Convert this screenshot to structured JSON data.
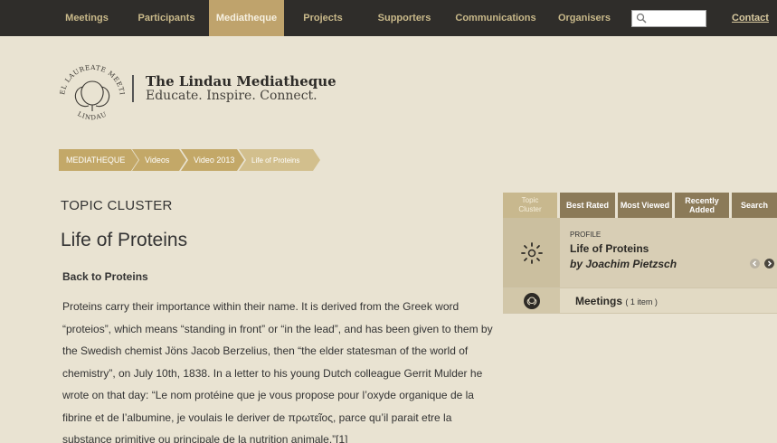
{
  "nav": {
    "items": [
      {
        "label": "Meetings",
        "active": false
      },
      {
        "label": "Participants",
        "active": false
      },
      {
        "label": "Mediatheque",
        "active": true
      },
      {
        "label": "Projects",
        "active": false
      },
      {
        "label": "Supporters",
        "active": false
      },
      {
        "label": "Communications",
        "active": false
      },
      {
        "label": "Organisers",
        "active": false
      }
    ],
    "search_value": "",
    "contact": "Contact"
  },
  "logo": {
    "emblem_text_top": "NOBEL LAUREATE MEETINGS",
    "emblem_text_bottom": "LINDAU",
    "title": "The Lindau Mediatheque",
    "tagline": "Educate. Inspire. Connect."
  },
  "breadcrumb": [
    "MEDIATHEQUE",
    "Videos",
    "Video 2013",
    "Life of Proteins"
  ],
  "content": {
    "section_label": "TOPIC CLUSTER",
    "title": "Life of Proteins",
    "back_link": "Back to Proteins",
    "paragraph": "Proteins carry their importance within their name. It is derived from the Greek word “proteios”, which means “standing in front” or “in the lead”, and has been given to them by the Swedish chemist Jöns Jacob Berzelius, then “the elder statesman of the world of chemistry”, on July 10th, 1838. In a letter to his young Dutch colleague Gerrit Mulder he wrote on that day: “Le nom protéine que je vous propose pour l’oxyde organique de la fibrine et de l’albumine, je voulais le deriver de πρωτεῖος, parce qu’il parait etre la substance primitive ou principale de la nutrition animale.”[1]"
  },
  "panel": {
    "tabs": [
      {
        "label": "Topic Cluster",
        "active": true
      },
      {
        "label": "Best Rated",
        "active": false
      },
      {
        "label": "Most Viewed",
        "active": false
      },
      {
        "label": "Recently Added",
        "active": false
      },
      {
        "label": "Search",
        "active": false
      }
    ],
    "profile": {
      "label": "PROFILE",
      "title": "Life of Proteins",
      "author": "by Joachim Pietzsch"
    },
    "meetings": {
      "label": "Meetings",
      "count": "( 1 item )"
    }
  },
  "colors": {
    "nav_bg": "#2f2d2a",
    "nav_active": "#bfa36c",
    "page_bg": "#e9e3d2",
    "breadcrumb": "#c3a868",
    "tab_dark": "#8b7a58"
  }
}
